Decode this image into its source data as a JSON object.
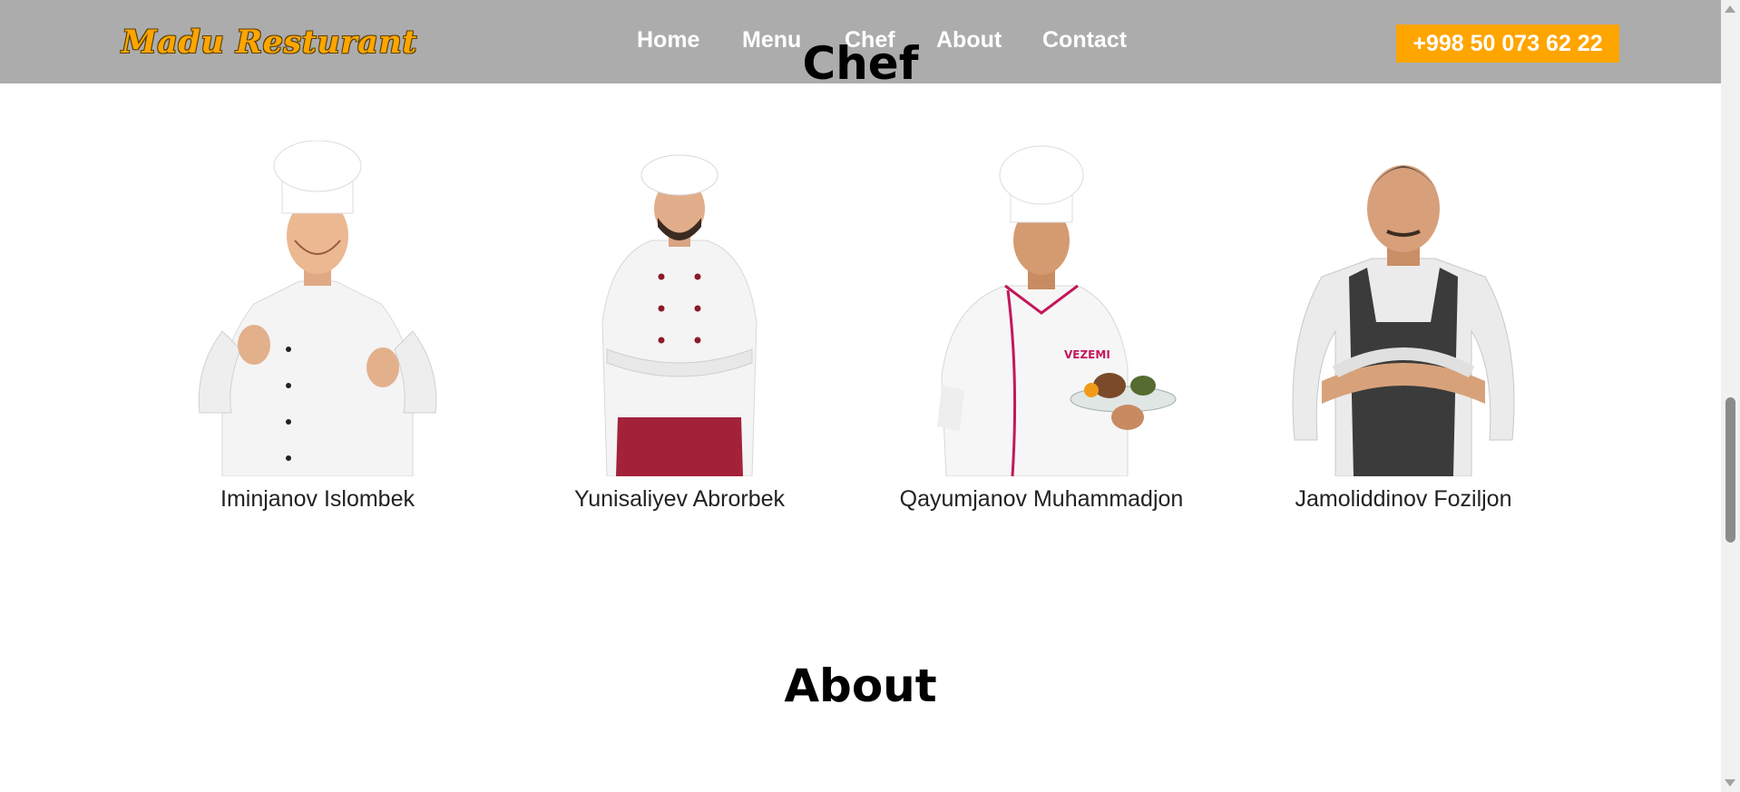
{
  "navbar": {
    "brand": "Madu Resturant",
    "links": [
      "Home",
      "Menu",
      "Chef",
      "About",
      "Contact"
    ],
    "phone": "+998 50 073 62 22"
  },
  "sections": {
    "chef_title": "Chef",
    "about_title": "About"
  },
  "chefs": [
    {
      "name": "Iminjanov Islombek"
    },
    {
      "name": "Yunisaliyev Abrorbek"
    },
    {
      "name": "Qayumjanov Muhammadjon"
    },
    {
      "name": "Jamoliddinov Foziljon"
    }
  ],
  "colors": {
    "accent": "#ffa500",
    "navbar_bg": "#acacac"
  }
}
